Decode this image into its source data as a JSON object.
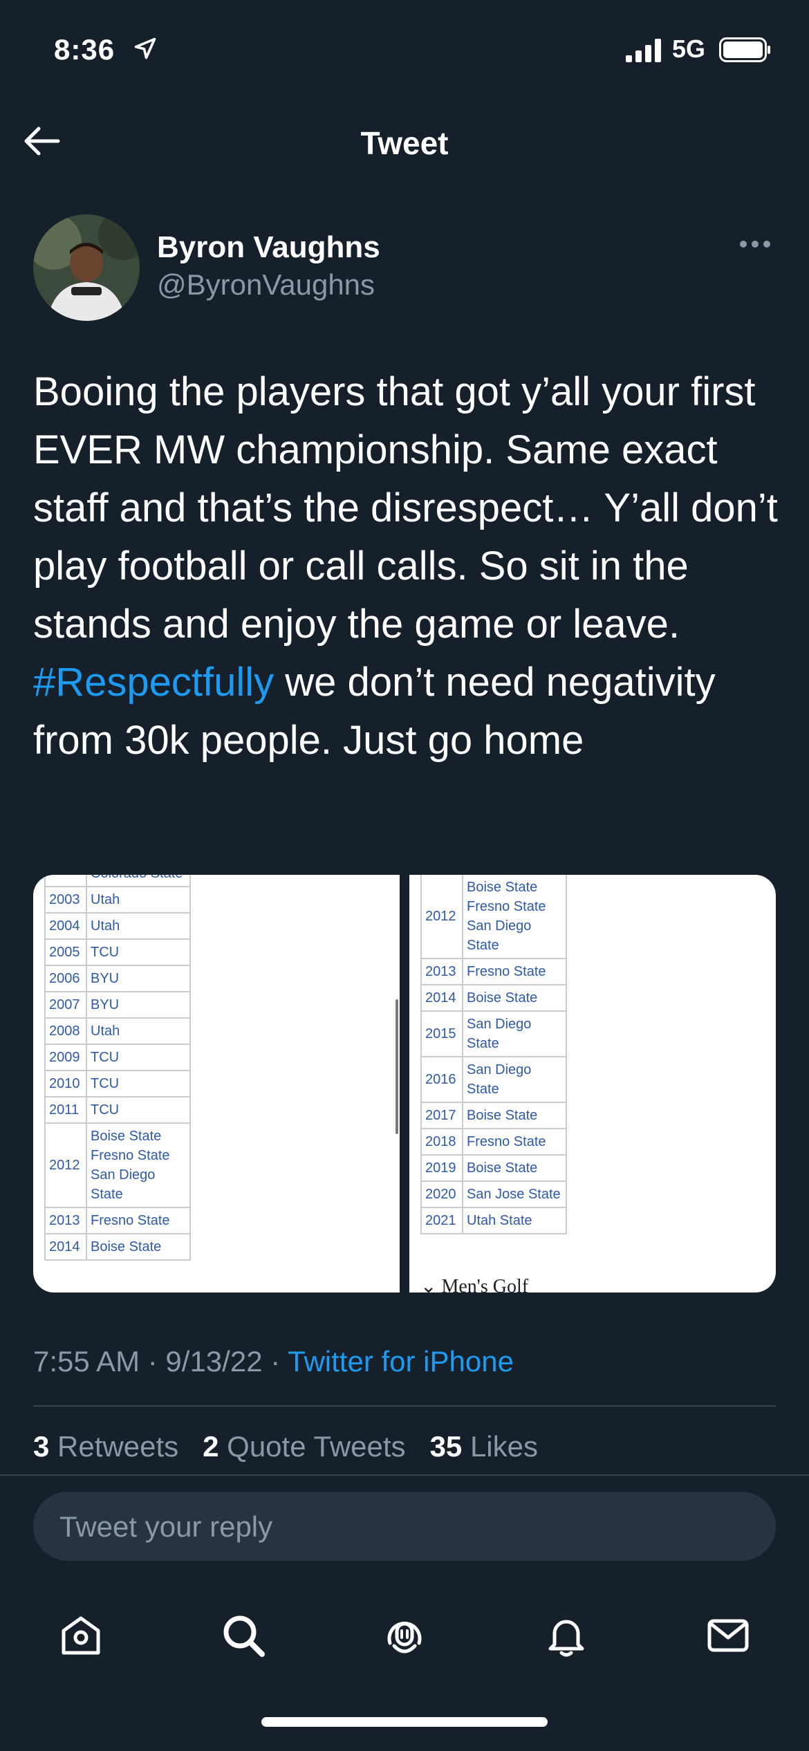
{
  "status_bar": {
    "time": "8:36",
    "network": "5G"
  },
  "nav": {
    "title": "Tweet"
  },
  "author": {
    "name": "Byron Vaughns",
    "handle": "@ByronVaughns"
  },
  "tweet": {
    "text_before": "Booing the players that got y’all your first EVER MW championship. Same exact staff and that’s the disrespect… Y’all don’t play football or call calls. So sit in the stands and enjoy the game or leave. ",
    "hashtag": "#Respectfully",
    "text_after": " we don’t need negativity from 30k people. Just go home",
    "time": "7:55 AM · 9/13/22 · ",
    "source": "Twitter for iPhone"
  },
  "media": {
    "left_table": [
      {
        "year": "",
        "names": [
          "Colorado State"
        ]
      },
      {
        "year": "2003",
        "names": [
          "Utah"
        ]
      },
      {
        "year": "2004",
        "names": [
          "Utah"
        ]
      },
      {
        "year": "2005",
        "names": [
          "TCU"
        ]
      },
      {
        "year": "2006",
        "names": [
          "BYU"
        ]
      },
      {
        "year": "2007",
        "names": [
          "BYU"
        ]
      },
      {
        "year": "2008",
        "names": [
          "Utah"
        ]
      },
      {
        "year": "2009",
        "names": [
          "TCU"
        ]
      },
      {
        "year": "2010",
        "names": [
          "TCU"
        ]
      },
      {
        "year": "2011",
        "names": [
          "TCU"
        ]
      },
      {
        "year": "2012",
        "names": [
          "Boise State",
          "Fresno State",
          "San Diego State"
        ]
      },
      {
        "year": "2013",
        "names": [
          "Fresno State"
        ]
      },
      {
        "year": "2014",
        "names": [
          "Boise State"
        ]
      }
    ],
    "right_table": [
      {
        "year": "2012",
        "names": [
          "Boise State",
          "Fresno State",
          "San Diego State"
        ]
      },
      {
        "year": "2013",
        "names": [
          "Fresno State"
        ]
      },
      {
        "year": "2014",
        "names": [
          "Boise State"
        ]
      },
      {
        "year": "2015",
        "names": [
          "San Diego State"
        ]
      },
      {
        "year": "2016",
        "names": [
          "San Diego State"
        ]
      },
      {
        "year": "2017",
        "names": [
          "Boise State"
        ]
      },
      {
        "year": "2018",
        "names": [
          "Fresno State"
        ]
      },
      {
        "year": "2019",
        "names": [
          "Boise State"
        ]
      },
      {
        "year": "2020",
        "names": [
          "San Jose State"
        ]
      },
      {
        "year": "2021",
        "names": [
          "Utah State"
        ]
      }
    ],
    "right_footer": "Men's Golf"
  },
  "stats": {
    "retweets_count": "3",
    "retweets_label": "Retweets",
    "quotes_count": "2",
    "quotes_label": "Quote Tweets",
    "likes_count": "35",
    "likes_label": "Likes"
  },
  "reply": {
    "placeholder": "Tweet your reply"
  },
  "tabs": [
    {
      "icon": "home-icon"
    },
    {
      "icon": "search-icon"
    },
    {
      "icon": "spaces-icon"
    },
    {
      "icon": "notifications-icon"
    },
    {
      "icon": "messages-icon"
    }
  ],
  "colors": {
    "background": "#15202b",
    "accent": "#1d9bf0",
    "secondary_text": "#8b98a5"
  }
}
